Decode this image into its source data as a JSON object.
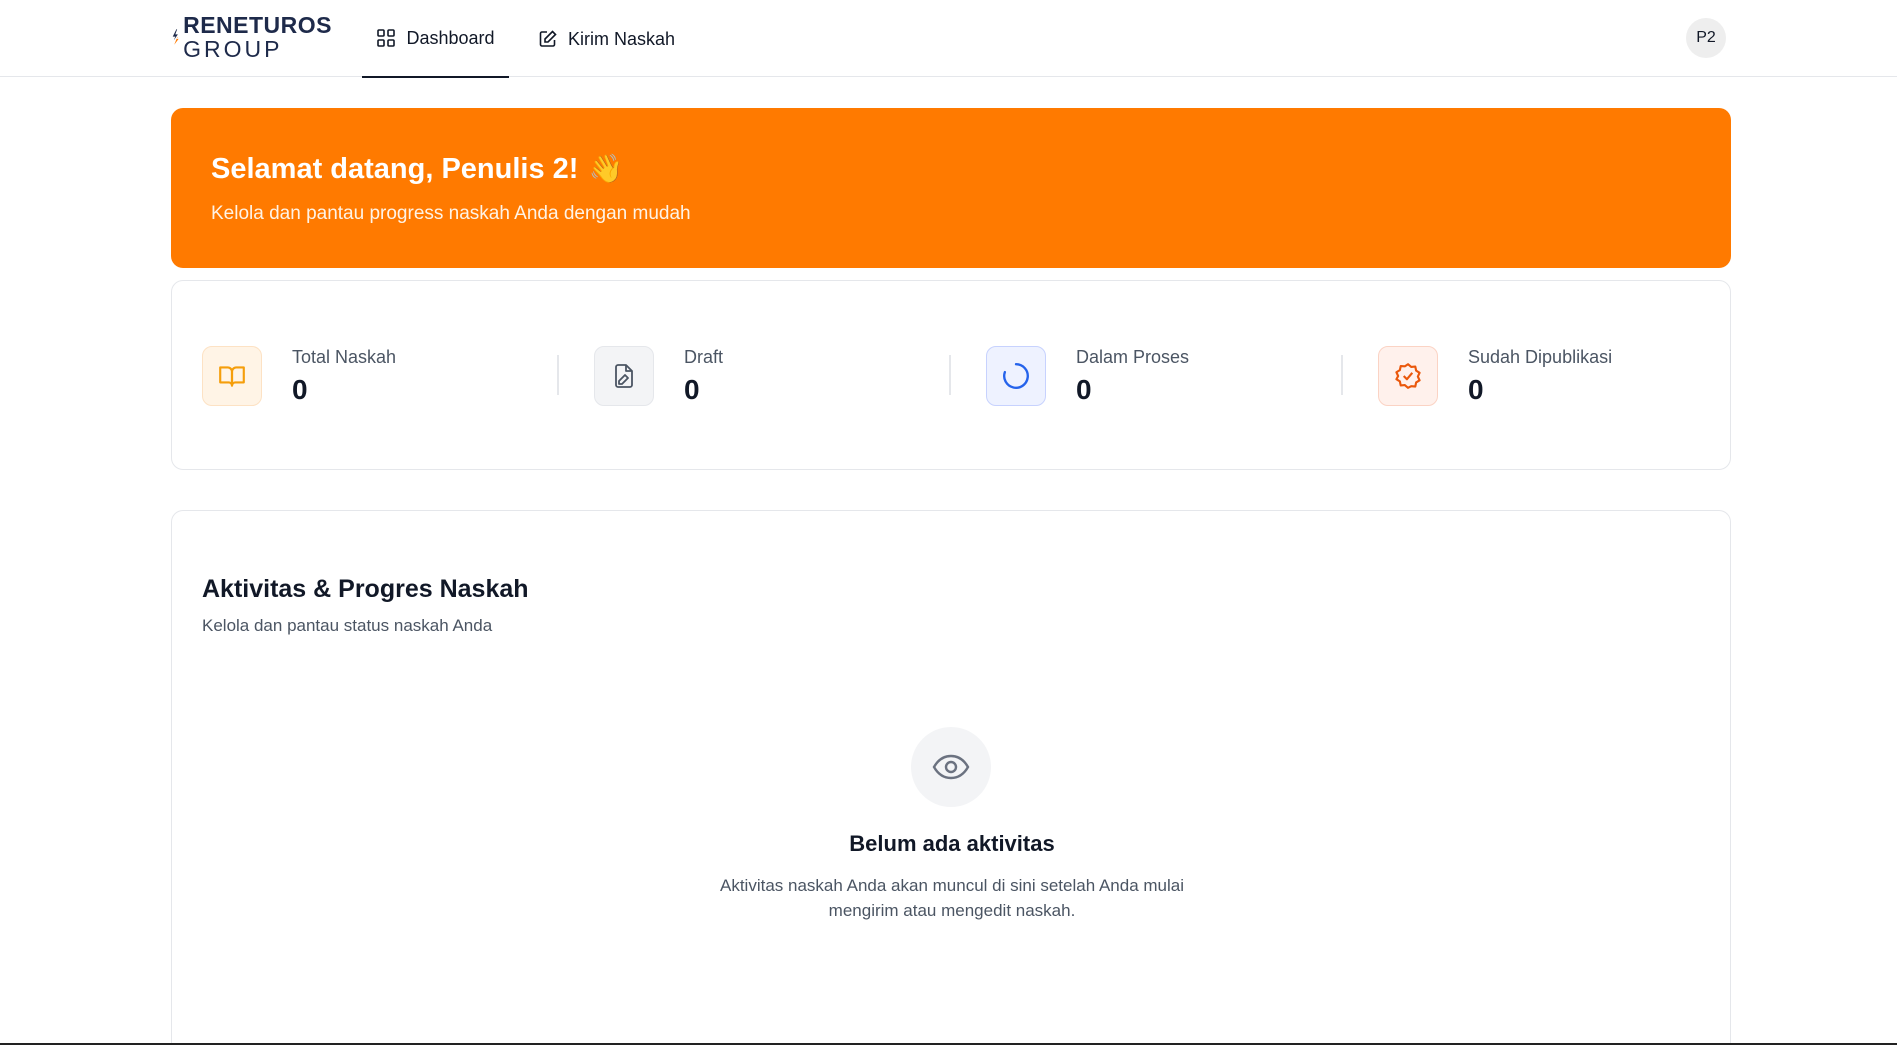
{
  "header": {
    "logo_line1": "RENETUROS",
    "logo_line2": "GROUP",
    "nav": [
      {
        "label": "Dashboard",
        "icon": "grid-icon",
        "active": true
      },
      {
        "label": "Kirim Naskah",
        "icon": "edit-icon",
        "active": false
      }
    ],
    "avatar_initials": "P2"
  },
  "banner": {
    "title": "Selamat datang, Penulis 2!",
    "emoji": "👋",
    "subtitle": "Kelola dan pantau progress naskah Anda dengan mudah",
    "color": "#ff7a00"
  },
  "stats": [
    {
      "label": "Total Naskah",
      "value": "0",
      "icon": "book-open-icon",
      "color": "#f59e0b"
    },
    {
      "label": "Draft",
      "value": "0",
      "icon": "file-edit-icon",
      "color": "#6b7280"
    },
    {
      "label": "Dalam Proses",
      "value": "0",
      "icon": "loader-icon",
      "color": "#2563eb"
    },
    {
      "label": "Sudah Dipublikasi",
      "value": "0",
      "icon": "badge-check-icon",
      "color": "#ea580c"
    }
  ],
  "activity": {
    "title": "Aktivitas & Progres Naskah",
    "subtitle": "Kelola dan pantau status naskah Anda",
    "empty_icon": "eye-icon",
    "empty_title": "Belum ada aktivitas",
    "empty_desc": "Aktivitas naskah Anda akan muncul di sini setelah Anda mulai mengirim atau mengedit naskah."
  }
}
